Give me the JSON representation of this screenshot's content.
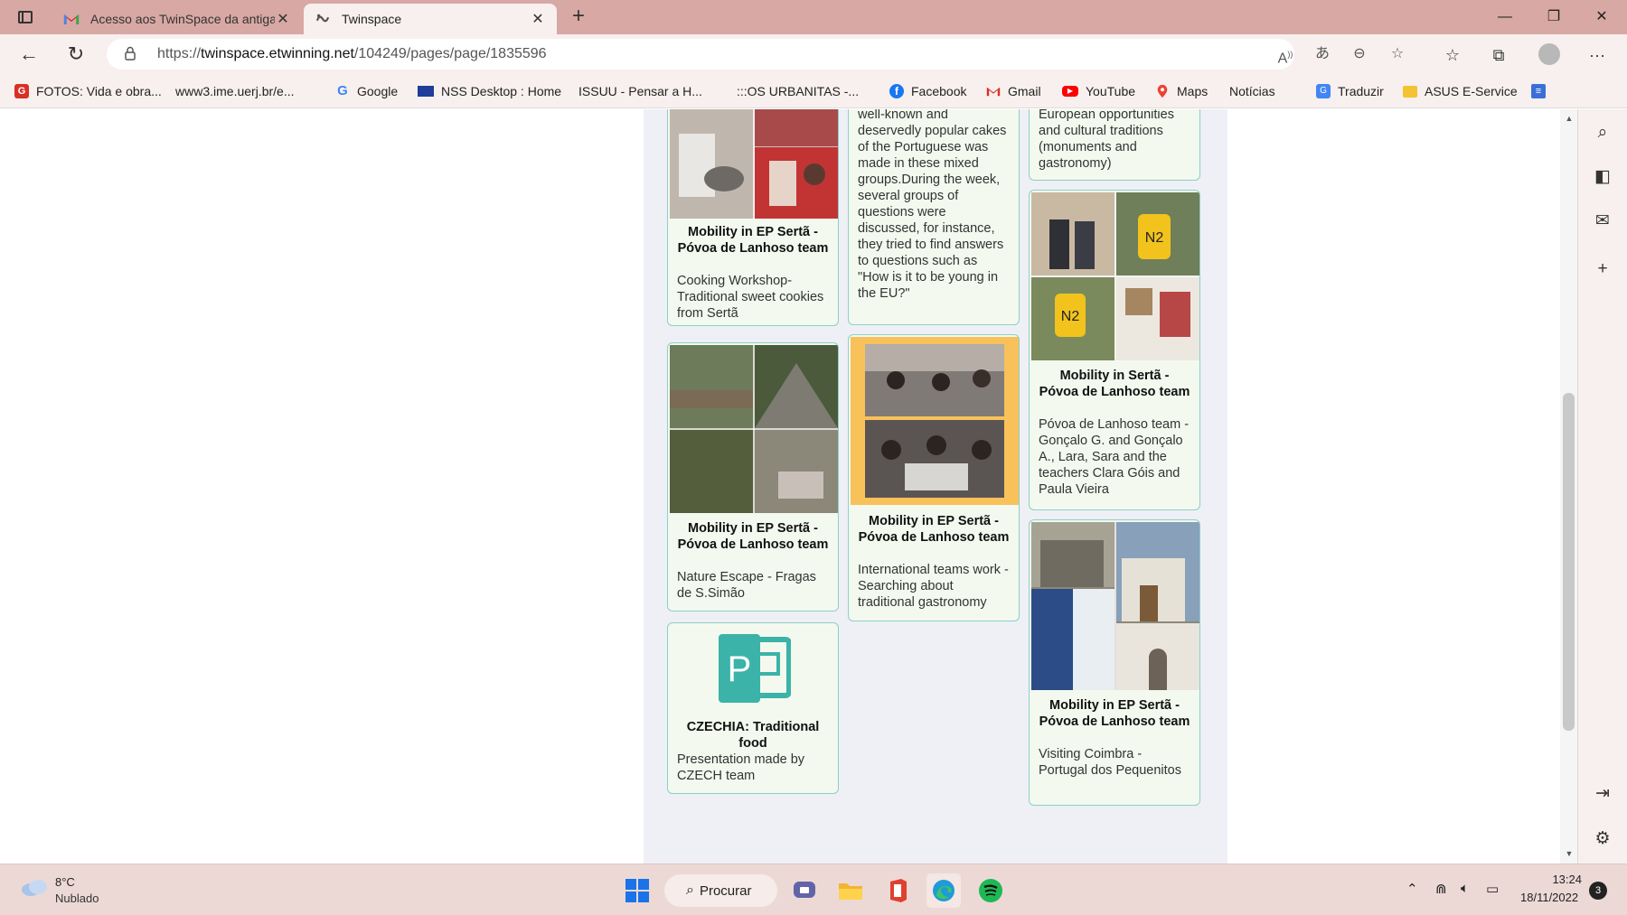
{
  "browser": {
    "tabs": [
      {
        "title": "Acesso aos TwinSpace da antiga",
        "active": false,
        "favicon": "gmail-icon"
      },
      {
        "title": "Twinspace",
        "active": true,
        "favicon": "twinspace-icon"
      }
    ],
    "url_prefix": "https://",
    "url_domain": "twinspace.etwinning.net",
    "url_path": "/104249/pages/page/1835596",
    "bookmarks": [
      {
        "label": "FOTOS: Vida e obra...",
        "icon": "g1-icon"
      },
      {
        "label": "www3.ime.uerj.br/e...",
        "icon": "page-icon"
      },
      {
        "label": "Google",
        "icon": "google-icon"
      },
      {
        "label": "NSS Desktop : Home",
        "icon": "eu-flag-icon"
      },
      {
        "label": "ISSUU - Pensar a H...",
        "icon": "page-icon"
      },
      {
        "label": ":::OS URBANITAS -...",
        "icon": "page-icon"
      },
      {
        "label": "Facebook",
        "icon": "facebook-icon"
      },
      {
        "label": "Gmail",
        "icon": "gmail-icon"
      },
      {
        "label": "YouTube",
        "icon": "youtube-icon"
      },
      {
        "label": "Maps",
        "icon": "maps-icon"
      },
      {
        "label": "Notícias",
        "icon": "page-icon"
      },
      {
        "label": "Traduzir",
        "icon": "translate-icon"
      },
      {
        "label": "ASUS E-Service",
        "icon": "folder-icon"
      }
    ]
  },
  "cards": {
    "c1": {
      "title": "Mobility in EP Sertã - Póvoa de Lanhoso team",
      "desc": "Cooking Workshop- Traditional sweet cookies from Sertã"
    },
    "c2": {
      "desc": "well-known and deservedly popular cakes of the Portuguese was made in these mixed groups.During the week, several groups of questions were discussed, for instance, they tried to find answers to questions such as \"How is it to be young in the EU?\""
    },
    "c3": {
      "desc": "European opportunities and cultural traditions (monuments and gastronomy)"
    },
    "c4": {
      "title": "Mobility in EP Sertã - Póvoa de Lanhoso team",
      "desc": "Nature Escape - Fragas de S.Simão"
    },
    "c5": {
      "title": "Mobility in EP Sertã - Póvoa de Lanhoso team",
      "desc": "International teams work - Searching about traditional gastronomy"
    },
    "c6": {
      "title": "Mobility in Sertã - Póvoa de Lanhoso team",
      "desc": "Póvoa de Lanhoso team -Gonçalo G. and Gonçalo A., Lara, Sara and the teachers Clara Góis and Paula Vieira"
    },
    "c7": {
      "title": "CZECHIA: Traditional food",
      "desc": "Presentation made by CZECH team"
    },
    "c8": {
      "title": "Mobility in EP Sertã - Póvoa de Lanhoso team",
      "desc": "Visiting Coimbra - Portugal dos Pequenitos"
    }
  },
  "taskbar": {
    "weather_temp": "8°C",
    "weather_desc": "Nublado",
    "search_label": "Procurar",
    "time": "13:24",
    "date": "18/11/2022",
    "notifications": "3"
  },
  "colors": {
    "tabstrip": "#d8a8a4",
    "card_bg": "#f3f9ee",
    "card_border": "#8ecfc7",
    "powerpoint": "#3bb3a8"
  }
}
